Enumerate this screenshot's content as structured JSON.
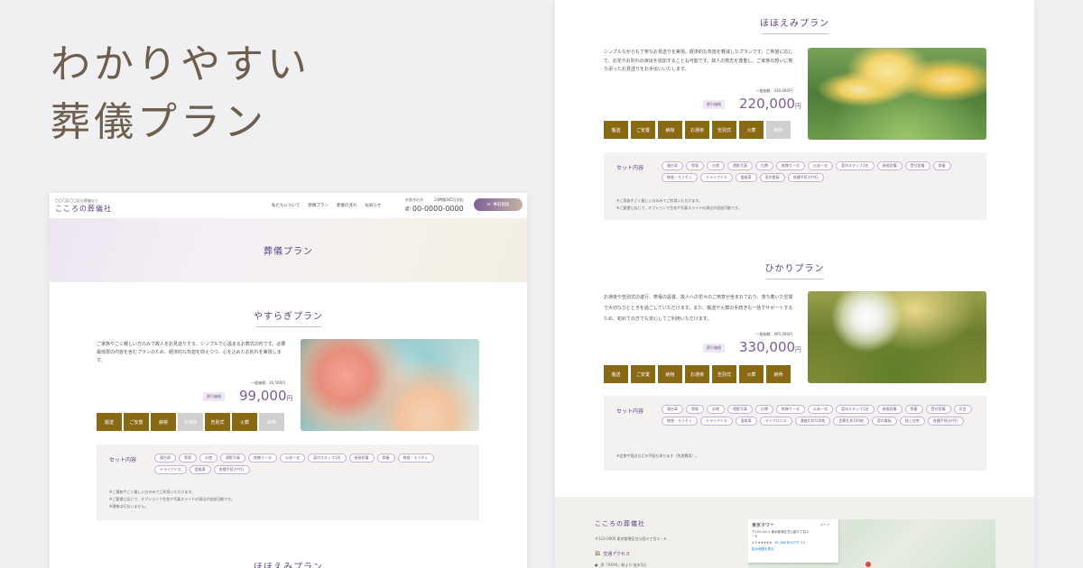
{
  "headline": {
    "line1": "わかりやすい",
    "line2": "葬儀プラン"
  },
  "header": {
    "tagline": "〇〇〇区〇〇区の葬儀なら",
    "site_name": "こころの葬儀社",
    "nav": [
      "私たちについて",
      "葬儀プラン",
      "葬儀の流れ",
      "お知らせ"
    ],
    "tel_label": "お急ぎの方",
    "tel_hours": "24時間365日対応",
    "tel_number": "00-0000-0000",
    "consult_label": "事前相談"
  },
  "hero": {
    "title": "葬儀プラン"
  },
  "flow_steps": [
    "搬送",
    "ご安置",
    "納棺",
    "お通夜",
    "告別式",
    "火葬",
    "納骨"
  ],
  "set_label": "セット内容",
  "plans": {
    "yasuragi": {
      "title": "やすらぎプラン",
      "description": "ご家族やごく親しい方のみで故人をお見送りする、シンプルで心温まるお葬式の形です。必要最低限の内容を含むプランのため、経済的な負担を抑えつつ、心を込めたお別れを実現します。",
      "list_price": "一般価格：16,500円",
      "badge": "割引価格",
      "price": "99,000",
      "unit": "円",
      "steps_active": [
        true,
        true,
        true,
        false,
        true,
        true,
        false
      ],
      "tags": [
        "寝台車",
        "祭壇",
        "お棺",
        "遺影写真",
        "枕飾り一式",
        "仏衣一式",
        "案内スタッフ1名",
        "焼香設備",
        "骨壷",
        "線香・ろうそく",
        "ドライアイス",
        "霊柩車",
        "各種手続き代行"
      ],
      "notes": [
        "※ご遺族やごく親しい方のみでご利用いただけます。",
        "※ご要望に応じて、オプションで生花や写真スライドの演出が追加可能です。",
        "※通夜は行ないません。"
      ]
    },
    "hohoemi": {
      "title": "ほほえみプラン",
      "description": "シンプルながらも丁寧なお見送りを実現。経済的な負担を軽減したプランです。ご希望に応じて、お花やお別れの演出を追加することも可能です。故人の意志を尊重し、ご家族の想いに寄り添ったお見送りをお手伝いいたします。",
      "list_price": "一般価格：330,000円",
      "badge": "割引価格",
      "price": "220,000",
      "unit": "円",
      "steps_active": [
        true,
        true,
        true,
        true,
        true,
        true,
        false
      ],
      "tags": [
        "寝台車",
        "祭壇",
        "お棺",
        "遺影写真",
        "位牌",
        "枕飾り一式",
        "仏衣一式",
        "案内スタッフ1名",
        "焼香設備",
        "受付設備",
        "骨壷",
        "線香・ろうそく",
        "ドライアイス",
        "霊柩車",
        "案内看板",
        "各種手続き代行"
      ],
      "notes": [
        "※ご家族やごく親しい方のみでご利用いただけます。",
        "※ご要望に応じて、オプションで生花や写真スライドの演出が追加可能です。"
      ]
    },
    "hikari": {
      "title": "ひかりプラン",
      "description": "お通夜や告別式の進行、祭壇の設置、故人への花々のご用意が含まれており、落ち着いた空間で大切なひとときを過ごしていただけます。また、搬送や火葬の手続きも一括でサポートするため、初めての方でも安心してご利用いただけます。",
      "list_price": "一般価格：495,000円",
      "badge": "割引価格",
      "price": "330,000",
      "unit": "円",
      "steps_active": [
        true,
        true,
        true,
        true,
        true,
        true,
        true
      ],
      "tags": [
        "寝台車",
        "祭壇",
        "お棺",
        "遺影写真",
        "位牌",
        "枕飾り一式",
        "仏衣一式",
        "案内スタッフ1名",
        "焼香設備",
        "骨壷",
        "受付設備",
        "司会",
        "線香・ろうそく",
        "ドライアイス",
        "霊柩車",
        "マイクロバス",
        "通夜礼状100枚",
        "会葬礼状100枚",
        "案内看板",
        "枕上花束",
        "各種手続き代行"
      ],
      "notes": [
        "※会食や宿泊などの手配も承ります（別途費用）。"
      ]
    }
  },
  "footer": {
    "company": "こころの葬儀社",
    "address": "〒123-0000 東京都港区芝公園４丁目２−８",
    "access": "交通アクセス",
    "station": "JR「XXXX」駅より 徒歩5分",
    "map": {
      "place": "東京タワー",
      "address": "〒105-0011 東京都港区芝公園４丁目２−８",
      "rating": "4.5 ★★★★★",
      "reviews": "81,266 件のクチコミ",
      "link": "拡大地図を表示",
      "route": "ルート"
    }
  },
  "colors": {
    "purple": "#5b3f7e",
    "gold": "#8a6914",
    "gray_step": "#cfcfcf",
    "set_bg": "#f3f2f1"
  }
}
